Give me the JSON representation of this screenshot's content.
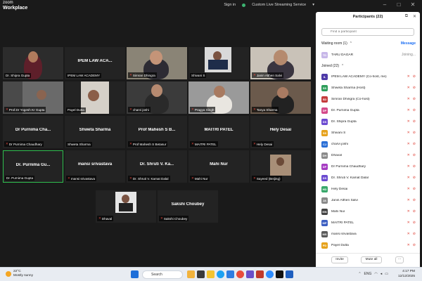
{
  "app": {
    "brand_line1": "zoom",
    "brand_line2": "Workplace"
  },
  "titlebar": {
    "signin": "Sign in",
    "stream": "Custom Live Streaming Service"
  },
  "panel": {
    "title": "Participants (22)",
    "search_placeholder": "Find a participant",
    "waiting_label": "Waiting room (1)",
    "message_label": "Message",
    "waiting": [
      {
        "initials": "TD",
        "name": "TARU DAGAR",
        "status": "Joining..."
      }
    ],
    "joined_label": "Joined (22)",
    "joined": [
      {
        "initials": "IL",
        "name": "IPEM LAW ACADEMY (Co-host, me)",
        "color": "#4e3aa8"
      },
      {
        "initials": "SS",
        "name": "Shweta Sharma (Host)",
        "color": "#2e9e5b"
      },
      {
        "initials": "SD",
        "name": "Simran Dhingra (Co-host)",
        "color": "#c43b3b"
      },
      {
        "initials": "DP",
        "name": "Dr. Purnima Gupta",
        "color": "#d44a8a"
      },
      {
        "initials": "DS",
        "name": "Dr. Shipra Gupta",
        "color": "#6c4bd1"
      },
      {
        "initials": "SS",
        "name": "Shivani S",
        "color": "#e6a21c"
      },
      {
        "initials": "CJ",
        "name": "charvi joshi",
        "color": "#2a6fd6"
      },
      {
        "initials": "DH",
        "name": "Dhaval",
        "color": "#8a8a8a"
      },
      {
        "initials": "DP",
        "name": "Dr Purnima Chaudhary",
        "color": "#a63dc2"
      },
      {
        "initials": "DS",
        "name": "Dr. Shruti V. Kamat Dalal",
        "color": "#6b4ad0"
      },
      {
        "initials": "HD",
        "name": "Hely Desai",
        "color": "#39a86b"
      },
      {
        "initials": "JA",
        "name": "Janin Althen Salvi",
        "color": "#8a8a8a"
      },
      {
        "initials": "MN",
        "name": "Mahi Nur",
        "color": "#444444"
      },
      {
        "initials": "MP",
        "name": "MAITRI PATEL",
        "color": "#3d5fc2"
      },
      {
        "initials": "MS",
        "name": "mansi srivastava",
        "color": "#5a5a5a"
      },
      {
        "initials": "PD",
        "name": "Payel Dutta",
        "color": "#e6a21c"
      }
    ],
    "invite_label": "Invite",
    "mute_all_label": "Mute all",
    "more_label": "···"
  },
  "tiles": [
    {
      "label": "Dr. Shipra Gupta",
      "center": "",
      "video": true
    },
    {
      "label": "IPEM LAW ACADEMY",
      "center": "IPEM LAW ACA...",
      "video": false
    },
    {
      "label": "Simran Dhingra",
      "center": "",
      "video": true
    },
    {
      "label": "Shivani S",
      "center": "",
      "video": true
    },
    {
      "label": "Janin Althen Salvi",
      "center": "",
      "video": true
    },
    {
      "label": "Prof.Dr Yogesh Kr Gupta",
      "center": "",
      "video": true
    },
    {
      "label": "Payel Dutta",
      "center": "",
      "video": true
    },
    {
      "label": "charvi joshi",
      "center": "",
      "video": true
    },
    {
      "label": "Pragya Singh",
      "center": "",
      "video": true
    },
    {
      "label": "Tanya Sharma",
      "center": "",
      "video": true
    },
    {
      "label": "Dr Purnima Chaudhary",
      "center": "Dr Purnima Cha...",
      "video": false
    },
    {
      "label": "Shweta Sharma",
      "center": "Shweta Sharma",
      "video": false
    },
    {
      "label": "Prof Mahesh S Betasur",
      "center": "Prof Mahesh S B...",
      "video": false
    },
    {
      "label": "MAITRI PATEL",
      "center": "MAITRI PATEL",
      "video": false
    },
    {
      "label": "Hely Desai",
      "center": "Hely Desai",
      "video": false
    },
    {
      "label": "Dr. Purnima Gupta",
      "center": "Dr. Purnima Gu...",
      "video": false
    },
    {
      "label": "mansi srivastava",
      "center": "mansi srivastava",
      "video": false
    },
    {
      "label": "Dr. Shruti V. Kamat Dalal",
      "center": "Dr. Shruti V. Ka...",
      "video": false
    },
    {
      "label": "Mahi Nur",
      "center": "Mahi Nur",
      "video": false
    },
    {
      "label": "Sayeed (Beijing)",
      "center": "",
      "video": true
    },
    {
      "label": "Dhaval",
      "center": "",
      "video": true
    },
    {
      "label": "Sakshi Choubey",
      "center": "Sakshi Choubey",
      "video": false
    }
  ],
  "taskbar": {
    "weather_temp": "22°C",
    "weather_desc": "Mostly sunny",
    "search_label": "Search",
    "time": "4:17 PM",
    "date": "12/12/2025",
    "lang": "ENG"
  }
}
